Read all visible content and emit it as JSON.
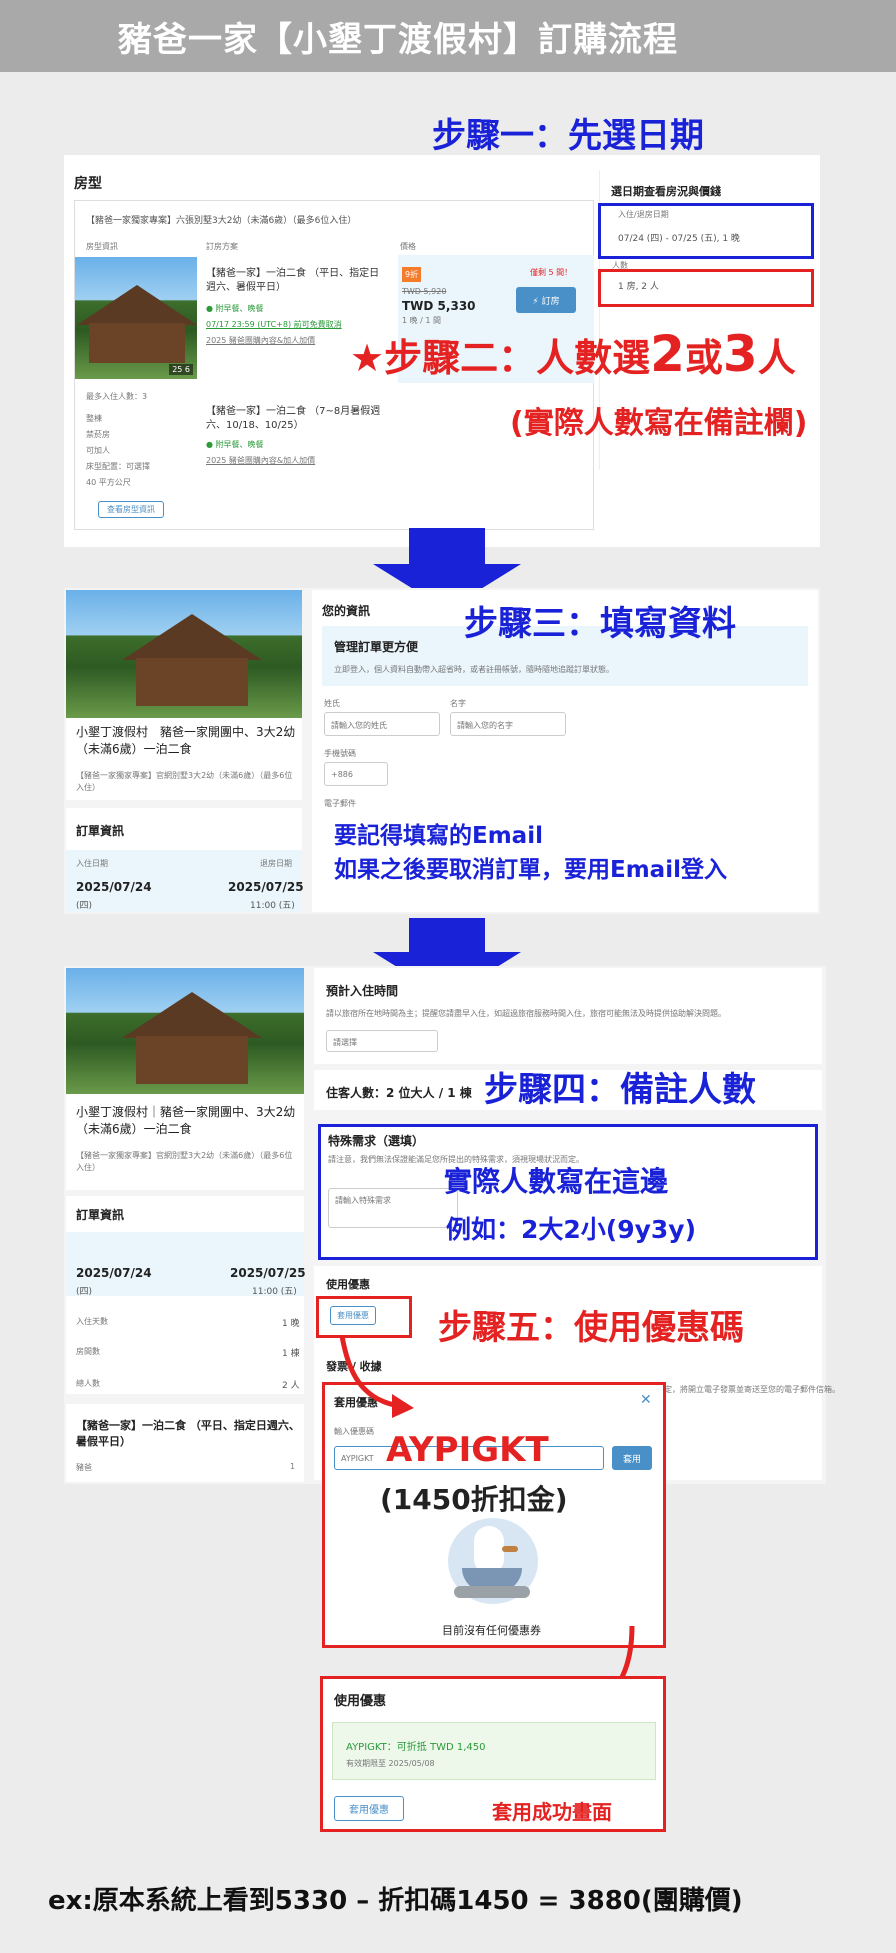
{
  "title": "豬爸一家【小墾丁渡假村】訂購流程",
  "step1": "步驟一：先選日期",
  "step2_star": "★",
  "step2_a": "步驟二：人數選",
  "step2_n1": "2",
  "step2_or": "或",
  "step2_n2": "3",
  "step2_b": "人",
  "step2_note": "(實際人數寫在備註欄)",
  "step3": "步驟三：填寫資料",
  "step3_note1": "要記得填寫的Email",
  "step3_note2": "如果之後要取消訂單，要用Email登入",
  "step4": "步驟四：備註人數",
  "step4_note1": "實際人數寫在這邊",
  "step4_note2": "例如：2大2小(9y3y)",
  "step5": "步驟五：使用優惠碼",
  "coupon_code": "AYPIGKT",
  "coupon_amount": "(1450折扣金)",
  "success_label": "套用成功畫面",
  "formula": "ex:原本系統上看到5330 – 折扣碼1450 = 3880(團購價)",
  "room": {
    "heading": "房型",
    "package": "【豬爸一家獨家專案】六張別墅3大2幼（未滿6歲）（最多6位入住）",
    "col1": "房型資訊",
    "col2": "訂房方案",
    "col3": "價格",
    "plan1": "【豬爸一家】一泊二食 （平日、指定日週六、暑假平日）",
    "plan1_tag1": "● 附早餐、晚餐",
    "plan1_tag2": "07/17 23:59 (UTC+8) 前可免費取消",
    "plan1_tag3": "2025 豬爸團購內容&加人加價",
    "plan2": "【豬爸一家】一泊二食 （7~8月暑假週六、10/18、10/25）",
    "plan2_tag1": "● 附早餐、晚餐",
    "plan2_tag2": "2025 豬爸團購內容&加人加價",
    "badge": "9折",
    "orig_price": "TWD 5,920",
    "price": "TWD 5,330",
    "per": "1 晚 / 1 間",
    "left": "僅剩 5 間！",
    "book": "⚡ 訂房",
    "photo_count": "25 6",
    "max": "最多入住人數：3",
    "feat1": "整棟",
    "feat2": "禁菸房",
    "feat3": "可加人",
    "feat4": "床型配置：可選擇",
    "feat5": "40 平方公尺",
    "more": "查看房型資訊",
    "side_title": "選日期查看房況與價錢",
    "date_label": "入住/退房日期",
    "date_value": "07/24 (四) - 07/25 (五), 1 晚",
    "guest_label": "人數",
    "guest_value": "1 房, 2 人"
  },
  "form": {
    "hotel": "小墾丁渡假村　豬爸一家開團中、3大2幼（未滿6歲）一泊二食",
    "sub": "【豬爸一家獨家專案】官網別墅3大2幼（未滿6歲）（最多6位入住）",
    "order_title": "訂單資訊",
    "checkin_label": "入住日期",
    "checkout_label": "退房日期",
    "checkin": "2025/07/24",
    "checkout": "2025/07/25",
    "checkin_day": "(四)",
    "checkout_day": "11:00 (五)",
    "your_info": "您的資訊",
    "manage": "管理訂單更方便",
    "manage_sub": "立即登入，個人資料自動帶入超省時，或者註冊帳號，隨時隨地追蹤訂單狀態。",
    "last": "姓氏",
    "first": "名字",
    "last_ph": "請輸入您的姓氏",
    "first_ph": "請輸入您的名字",
    "phone": "手機號碼",
    "code": "+886",
    "email": "電子郵件"
  },
  "notes": {
    "hotel": "小墾丁渡假村｜豬爸一家開團中、3大2幼（未滿6歲）一泊二食",
    "sub": "【豬爸一家獨家專案】官網別墅3大2幼（未滿6歲）（最多6位入住）",
    "order_title": "訂單資訊",
    "checkin": "2025/07/24",
    "checkout": "2025/07/25",
    "checkin_day": "(四)",
    "checkout_day": "11:00 (五)",
    "nights_label": "入住天數",
    "nights": "1 晚",
    "rooms_label": "房間數",
    "rooms": "1 棟",
    "people_label": "總人數",
    "people": "2 人",
    "plan": "【豬爸一家】一泊二食 （平日、指定日週六、暑假平日）",
    "plan_sub": "豬爸",
    "plan_qty": "1",
    "arrival": "預計入住時間",
    "arrival_sub": "請以旅宿所在地時間為主；提醒您請盡早入住，如超過旅宿服務時間入住，旅宿可能無法及時提供協助解決問題。",
    "arrival_ph": "請選擇",
    "guests": "住客人數：2 位大人 / 1 棟",
    "special": "特殊需求（選填）",
    "special_sub": "請注意，我們無法保證能滿足您所提出的特殊需求，須視現場狀況而定。",
    "special_ph": "請輸入特殊需求",
    "coupon_heading": "使用優惠",
    "coupon_btn": "套用優惠",
    "invoice": "發票 / 收據",
    "invoice_sub": "依法規定，將開立電子發票並寄送至您的電子郵件信箱。"
  },
  "modal": {
    "title": "套用優惠",
    "label": "輸入優惠碼",
    "input": "AYPIGKT",
    "apply": "套用",
    "empty": "目前沒有任何優惠券",
    "close": "✕"
  },
  "applied": {
    "heading": "使用優惠",
    "line1": "AYPIGKT：可折抵 TWD 1,450",
    "line2": "有效期限至 2025/05/08",
    "btn": "套用優惠"
  }
}
